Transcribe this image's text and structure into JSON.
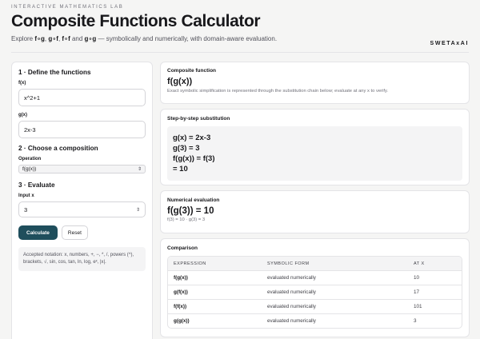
{
  "header": {
    "kicker": "INTERACTIVE MATHEMATICS LAB",
    "title": "Composite Functions Calculator",
    "subtitle_prefix": "Explore ",
    "subtitle_ops": [
      "f∘g",
      "g∘f",
      "f∘f",
      "g∘g"
    ],
    "subtitle_suffix": " — symbolically and numerically, with domain-aware evaluation.",
    "brand": "SWETAxAI"
  },
  "define": {
    "title": "1 · Define the functions",
    "f_label": "f(x)",
    "f_value": "x^2+1",
    "g_label": "g(x)",
    "g_value": "2x-3"
  },
  "compose": {
    "title": "2 · Choose a composition",
    "operation_label": "Operation",
    "operation_value": "f(g(x))"
  },
  "evaluate": {
    "title": "3 · Evaluate",
    "input_label": "Input x",
    "input_value": "3",
    "calculate_label": "Calculate",
    "reset_label": "Reset",
    "notation": "Accepted notation: x, numbers, +, −, *, /, powers (^), brackets, √, sin, cos, tan, ln, log, eˣ, |x|."
  },
  "composite": {
    "title": "Composite function",
    "expression": "f(g(x))",
    "note": "Exact symbolic simplification is represented through the substitution chain below; evaluate at any x to verify."
  },
  "steps": {
    "title": "Step-by-step substitution",
    "lines": [
      "g(x) = 2x-3",
      "g(3) = 3",
      "f(g(x)) = f(3)",
      "= 10"
    ]
  },
  "numeric": {
    "title": "Numerical evaluation",
    "result": "f(g(3)) = 10",
    "detail": "f(3) = 10 · g(3) = 3"
  },
  "comparison": {
    "title": "Comparison",
    "headers": [
      "EXPRESSION",
      "SYMBOLIC FORM",
      "AT X"
    ],
    "rows": [
      [
        "f(g(x))",
        "evaluated numerically",
        "10"
      ],
      [
        "g(f(x))",
        "evaluated numerically",
        "17"
      ],
      [
        "f(f(x))",
        "evaluated numerically",
        "101"
      ],
      [
        "g(g(x))",
        "evaluated numerically",
        "3"
      ]
    ]
  },
  "icons": {
    "select_chevron": "updown-chevron-icon",
    "stepper": "stepper-icon"
  },
  "colors": {
    "primary_button": "#1f4e5c",
    "background": "#f5f5f4"
  }
}
